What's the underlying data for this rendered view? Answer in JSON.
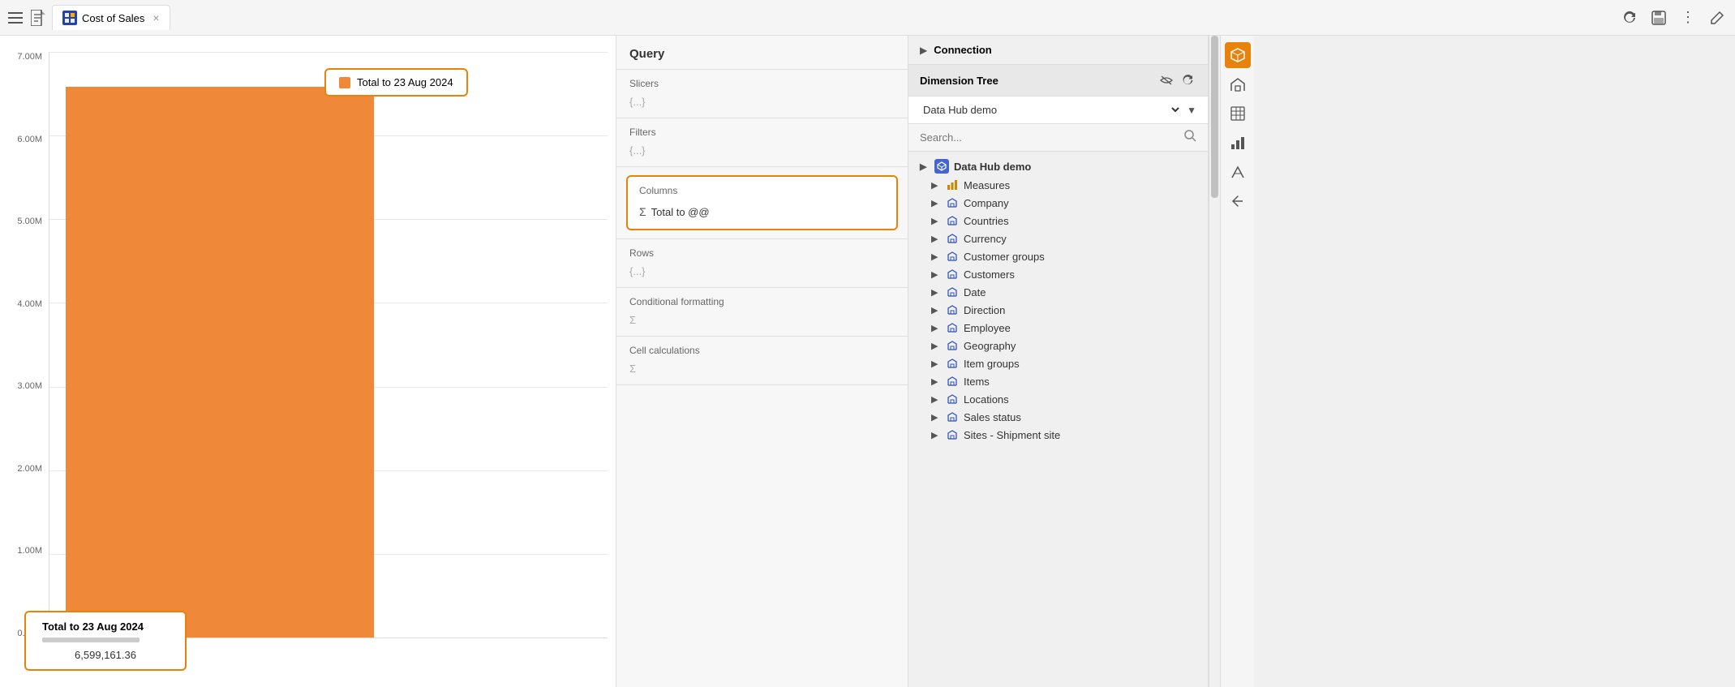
{
  "topbar": {
    "title": "Cost of Sales",
    "tab_label": "Cost of Sales",
    "close_label": "×"
  },
  "chart": {
    "legend_label": "Total to 23 Aug 2024",
    "y_labels": [
      "7.00M",
      "6.00M",
      "5.00M",
      "4.00M",
      "3.00M",
      "2.00M",
      "1.00M",
      "0.00M"
    ],
    "tooltip_title": "Total to 23 Aug 2024",
    "tooltip_value": "6,599,161.36"
  },
  "query": {
    "header": "Query",
    "slicers_label": "Slicers",
    "slicers_placeholder": "{...}",
    "filters_label": "Filters",
    "filters_placeholder": "{...}",
    "columns_label": "Columns",
    "columns_item": "Total to @@",
    "rows_label": "Rows",
    "rows_placeholder": "{...}",
    "cond_format_label": "Conditional formatting",
    "cond_format_placeholder": "Σ",
    "cell_calc_label": "Cell calculations",
    "cell_calc_placeholder": "Σ"
  },
  "right_panel": {
    "connection_label": "Connection",
    "dim_tree_label": "Dimension Tree",
    "datasource": "Data Hub demo",
    "search_placeholder": "Search...",
    "root_label": "Data Hub demo",
    "tree_items": [
      {
        "label": "Measures",
        "is_measures": true
      },
      {
        "label": "Company"
      },
      {
        "label": "Countries"
      },
      {
        "label": "Currency"
      },
      {
        "label": "Customer groups"
      },
      {
        "label": "Customers"
      },
      {
        "label": "Date"
      },
      {
        "label": "Direction"
      },
      {
        "label": "Employee"
      },
      {
        "label": "Geography"
      },
      {
        "label": "Item groups"
      },
      {
        "label": "Items"
      },
      {
        "label": "Locations"
      },
      {
        "label": "Sales status"
      },
      {
        "label": "Sites - Shipment site"
      }
    ]
  },
  "toolbar": {
    "refresh_title": "Refresh",
    "save_title": "Save",
    "more_title": "More",
    "edit_title": "Edit",
    "home_title": "Home",
    "table_title": "Table",
    "grid_title": "Grid",
    "chart_title": "Chart",
    "measure_title": "Measure",
    "back_title": "Back"
  },
  "icons": {
    "hamburger": "☰",
    "doc": "📄",
    "tab_grid": "⊞",
    "close": "×",
    "refresh": "↺",
    "save": "💾",
    "more": "⋮",
    "edit": "✎",
    "eye_off": "👁",
    "reload": "↺",
    "sigma": "Σ",
    "expand": "▶",
    "home": "⌂",
    "table": "≡",
    "grid_view": "⊞",
    "bar_chart": "📊",
    "line_chart": "📈",
    "back": "↩",
    "search": "🔍",
    "cube": "⬡",
    "dropdown_arrow": "▼"
  }
}
